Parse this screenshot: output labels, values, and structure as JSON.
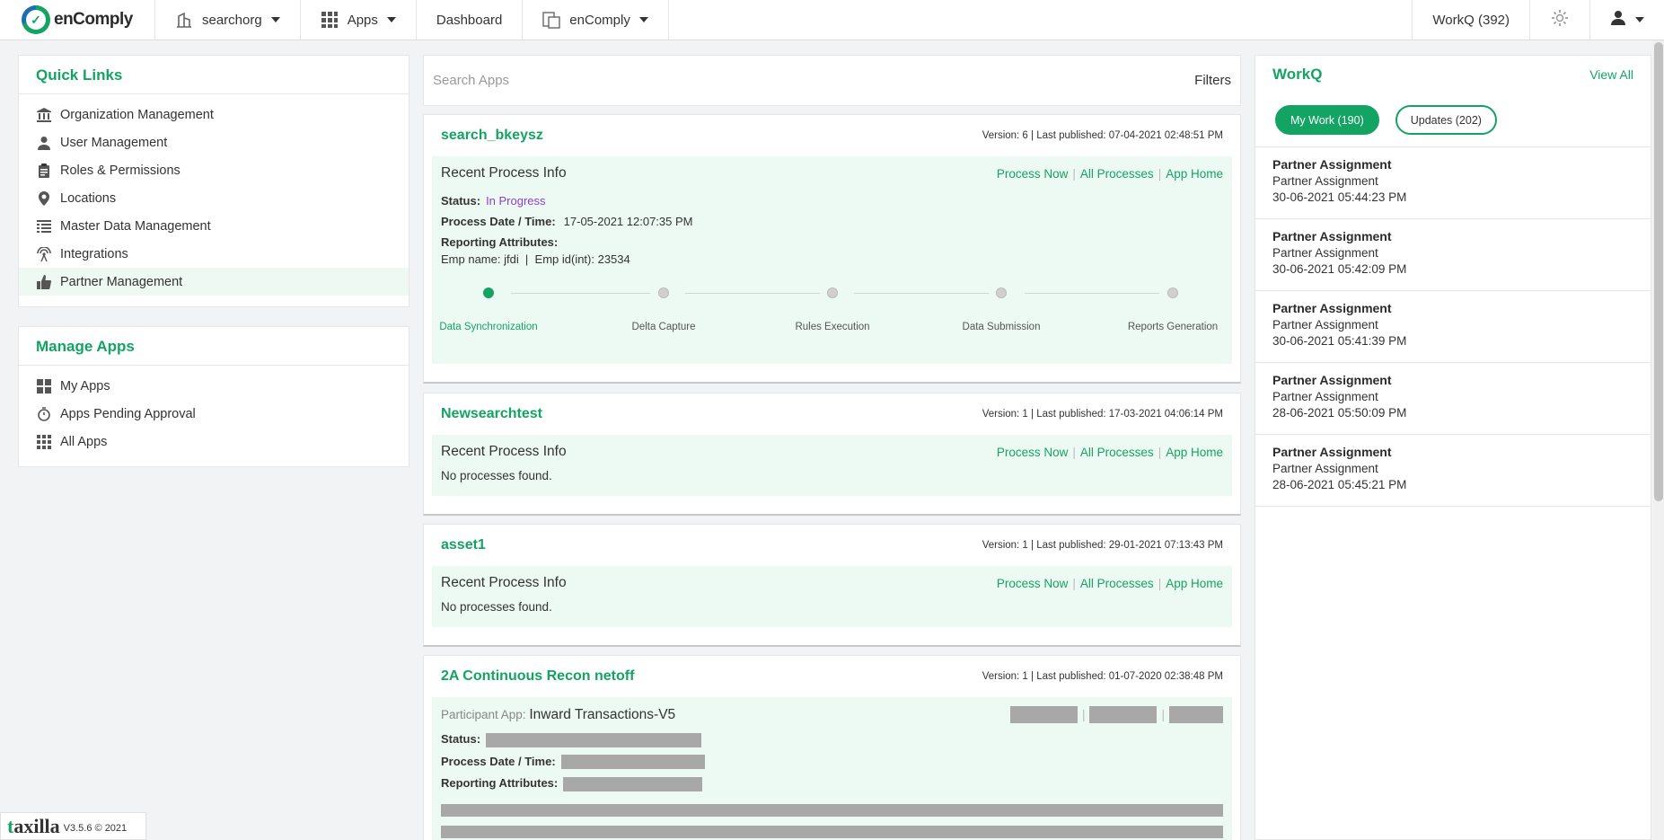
{
  "topbar": {
    "logo_text": "enComply",
    "org": "searchorg",
    "apps": "Apps",
    "dashboard": "Dashboard",
    "product": "enComply",
    "workq": "WorkQ (392)"
  },
  "quick_links": {
    "title": "Quick Links",
    "items": [
      {
        "label": "Organization Management",
        "icon": "bank-icon"
      },
      {
        "label": "User Management",
        "icon": "user-icon"
      },
      {
        "label": "Roles & Permissions",
        "icon": "clipboard-icon"
      },
      {
        "label": "Locations",
        "icon": "location-pin-icon"
      },
      {
        "label": "Master Data Management",
        "icon": "table-icon"
      },
      {
        "label": "Integrations",
        "icon": "broadcast-icon"
      },
      {
        "label": "Partner Management",
        "icon": "thumbs-up-icon"
      }
    ]
  },
  "manage_apps": {
    "title": "Manage Apps",
    "items": [
      {
        "label": "My Apps",
        "icon": "apps-grid-icon"
      },
      {
        "label": "Apps Pending Approval",
        "icon": "stopwatch-icon"
      },
      {
        "label": "All Apps",
        "icon": "dots-grid-icon"
      }
    ]
  },
  "search": {
    "placeholder": "Search Apps",
    "filters": "Filters"
  },
  "cards": [
    {
      "name": "search_bkeysz",
      "version": "Version: 6 | Last published: 07-04-2021 02:48:51 PM",
      "recent": "Recent Process Info",
      "links": [
        "Process Now",
        "All Processes",
        "App Home"
      ],
      "status_label": "Status:",
      "status": "In Progress",
      "date_label": "Process Date / Time:",
      "date": "17-05-2021 12:07:35 PM",
      "attr_label": "Reporting Attributes:",
      "attrs": "Emp name: jfdi  |  Emp id(int): 23534",
      "steps": [
        "Data Synchronization",
        "Delta Capture",
        "Rules Execution",
        "Data Submission",
        "Reports Generation"
      ]
    },
    {
      "name": "Newsearchtest",
      "version": "Version: 1 | Last published: 17-03-2021 04:06:14 PM",
      "recent": "Recent Process Info",
      "links": [
        "Process Now",
        "All Processes",
        "App Home"
      ],
      "empty": "No processes found."
    },
    {
      "name": "asset1",
      "version": "Version: 1 | Last published: 29-01-2021 07:13:43 PM",
      "recent": "Recent Process Info",
      "links": [
        "Process Now",
        "All Processes",
        "App Home"
      ],
      "empty": "No processes found."
    },
    {
      "name": "2A Continuous Recon netoff",
      "version": "Version: 1 | Last published: 01-07-2020 02:38:48 PM",
      "participant_label": "Participant App:",
      "participant": "Inward Transactions-V5",
      "status_label": "Status:",
      "date_label": "Process Date / Time:",
      "attr_label": "Reporting Attributes:"
    }
  ],
  "workq": {
    "title": "WorkQ",
    "view_all": "View All",
    "tab_mywork": "My Work (190)",
    "tab_updates": "Updates (202)",
    "items": [
      {
        "title": "Partner Assignment",
        "sub": "Partner Assignment",
        "date": "30-06-2021 05:44:23 PM"
      },
      {
        "title": "Partner Assignment",
        "sub": "Partner Assignment",
        "date": "30-06-2021 05:42:09 PM"
      },
      {
        "title": "Partner Assignment",
        "sub": "Partner Assignment",
        "date": "30-06-2021 05:41:39 PM"
      },
      {
        "title": "Partner Assignment",
        "sub": "Partner Assignment",
        "date": "28-06-2021 05:50:09 PM"
      },
      {
        "title": "Partner Assignment",
        "sub": "Partner Assignment",
        "date": "28-06-2021 05:45:21 PM"
      }
    ]
  },
  "footer": {
    "brand_t": "t",
    "brand_rest": "axilla",
    "version": "V3.5.6 © 2021"
  },
  "colors": {
    "accent": "#13a463",
    "status_in_progress": "#8a3fd1",
    "process_bg": "#edfaf3"
  }
}
